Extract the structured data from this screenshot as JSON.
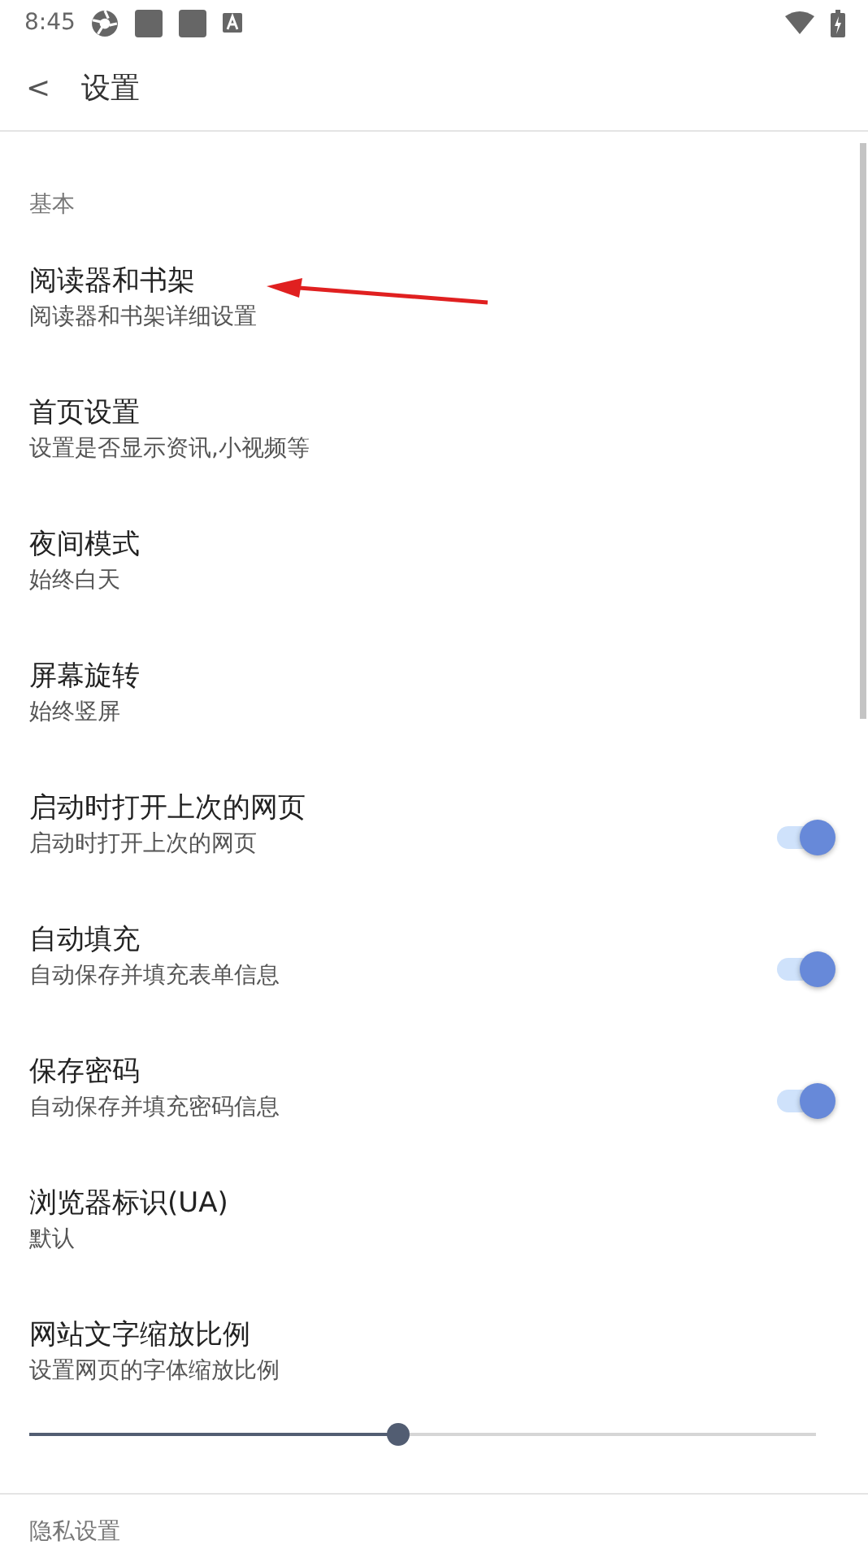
{
  "status_bar": {
    "time": "8:45"
  },
  "header": {
    "back": "<",
    "title": "设置"
  },
  "sections": [
    {
      "label": "基本",
      "items": [
        {
          "kind": "link",
          "title": "阅读器和书架",
          "subtitle": "阅读器和书架详细设置"
        },
        {
          "kind": "link",
          "title": "首页设置",
          "subtitle": "设置是否显示资讯,小视频等"
        },
        {
          "kind": "link",
          "title": "夜间模式",
          "subtitle": "始终白天"
        },
        {
          "kind": "link",
          "title": "屏幕旋转",
          "subtitle": "始终竖屏"
        },
        {
          "kind": "switch",
          "title": "启动时打开上次的网页",
          "subtitle": "启动时打开上次的网页",
          "on": true
        },
        {
          "kind": "switch",
          "title": "自动填充",
          "subtitle": "自动保存并填充表单信息",
          "on": true
        },
        {
          "kind": "switch",
          "title": "保存密码",
          "subtitle": "自动保存并填充密码信息",
          "on": true
        },
        {
          "kind": "link",
          "title": "浏览器标识(UA)",
          "subtitle": "默认"
        },
        {
          "kind": "slider",
          "title": "网站文字缩放比例",
          "subtitle": "设置网页的字体缩放比例",
          "level": 0.47
        }
      ]
    },
    {
      "label": "隐私设置"
    }
  ]
}
